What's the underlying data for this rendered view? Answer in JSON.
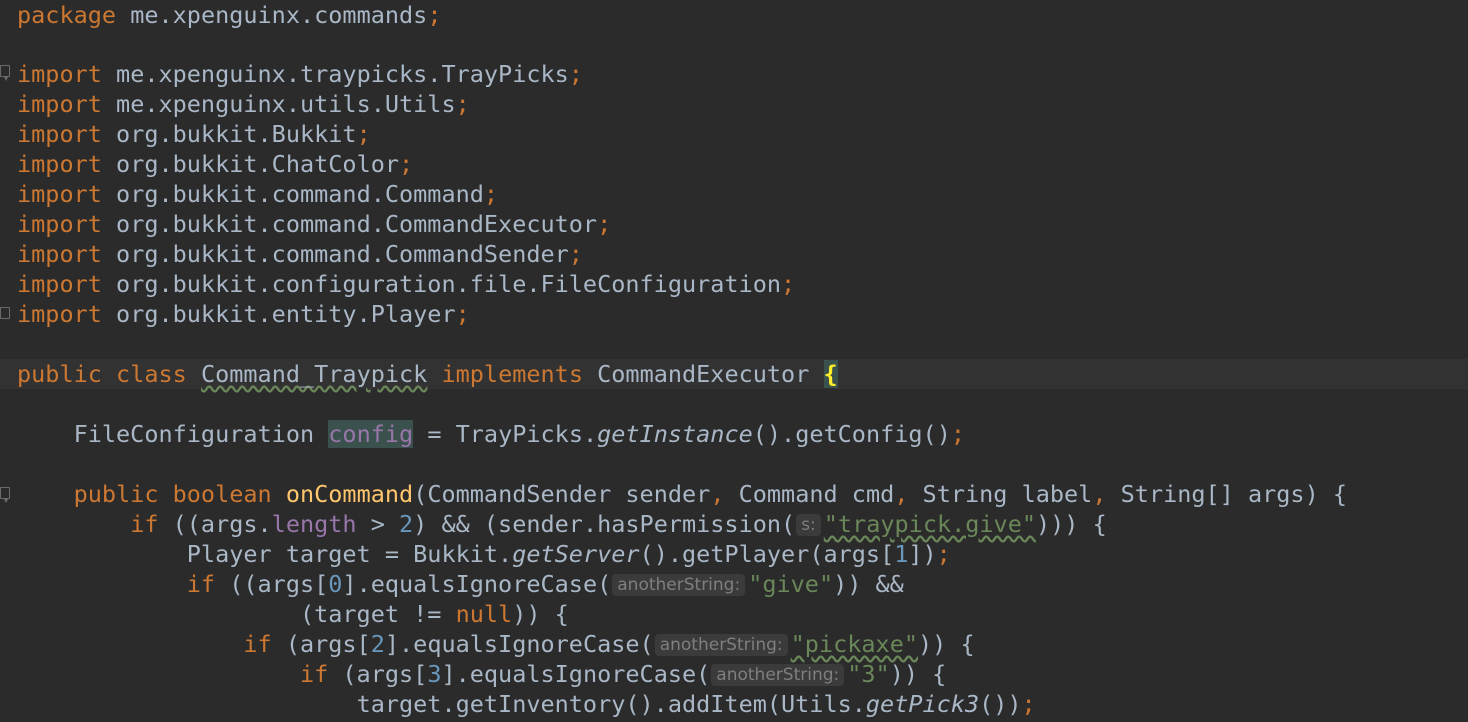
{
  "editor": {
    "language": "java",
    "package_line": {
      "keyword": "package",
      "name": "me.xpenguinx.commands",
      "semi": ";"
    },
    "imports": [
      "me.xpenguinx.traypicks.TrayPicks",
      "me.xpenguinx.utils.Utils",
      "org.bukkit.Bukkit",
      "org.bukkit.ChatColor",
      "org.bukkit.command.Command",
      "org.bukkit.command.CommandExecutor",
      "org.bukkit.command.CommandSender",
      "org.bukkit.configuration.file.FileConfiguration",
      "org.bukkit.entity.Player"
    ],
    "import_keyword": "import",
    "semicolon": ";",
    "class_decl": {
      "kw_public": "public",
      "kw_class": "class",
      "name": "Command_Traypick",
      "kw_implements": "implements",
      "iface": "CommandExecutor",
      "brace": "{"
    },
    "field_decl": {
      "type": "FileConfiguration",
      "name": "config",
      "eq": "=",
      "call_owner": "TrayPicks.",
      "call_static": "getInstance",
      "call_rest": "().getConfig()",
      "semi": ";"
    },
    "method_decl": {
      "kw_public": "public",
      "kw_boolean": "boolean",
      "name": "onCommand",
      "params_1": "(CommandSender sender",
      "comma": ",",
      "params_2": " Command cmd",
      "params_3": " String label",
      "params_4": " String[] args) {"
    },
    "body": {
      "l1_if": "if",
      "l1_a": " ((args.",
      "l1_field": "length",
      "l1_b": " > ",
      "l1_num": "2",
      "l1_c": ") && (sender.hasPermission(",
      "l1_hint": "s:",
      "l1_str": "\"traypick.give\"",
      "l1_d": "))) {",
      "l2_a": "Player target = Bukkit.",
      "l2_static": "getServer",
      "l2_b": "().getPlayer(args[",
      "l2_num": "1",
      "l2_c": "])",
      "l2_semi": ";",
      "l3_if": "if",
      "l3_a": " ((args[",
      "l3_num": "0",
      "l3_b": "].equalsIgnoreCase(",
      "l3_hint": "anotherString:",
      "l3_str": "\"give\"",
      "l3_c": ")) &&",
      "l4_a": "(target != ",
      "l4_null": "null",
      "l4_b": ")) {",
      "l5_if": "if",
      "l5_a": " (args[",
      "l5_num": "2",
      "l5_b": "].equalsIgnoreCase(",
      "l5_hint": "anotherString:",
      "l5_str": "\"pickaxe\"",
      "l5_c": ")) {",
      "l6_if": "if",
      "l6_a": " (args[",
      "l6_num": "3",
      "l6_b": "].equalsIgnoreCase(",
      "l6_hint": "anotherString:",
      "l6_str": "\"3\"",
      "l6_c": ")) {",
      "l7_a": "target.getInventory().addItem(Utils.",
      "l7_static": "getPick3",
      "l7_b": "())",
      "l7_semi": ";"
    },
    "colors": {
      "background": "#2b2b2b",
      "keyword": "#cc7832",
      "identifier": "#a9b7c6",
      "string": "#6a8759",
      "number": "#6897bb",
      "field": "#9876aa",
      "method_declaration": "#ffc66d",
      "hint_text": "#7f7f7f"
    }
  }
}
